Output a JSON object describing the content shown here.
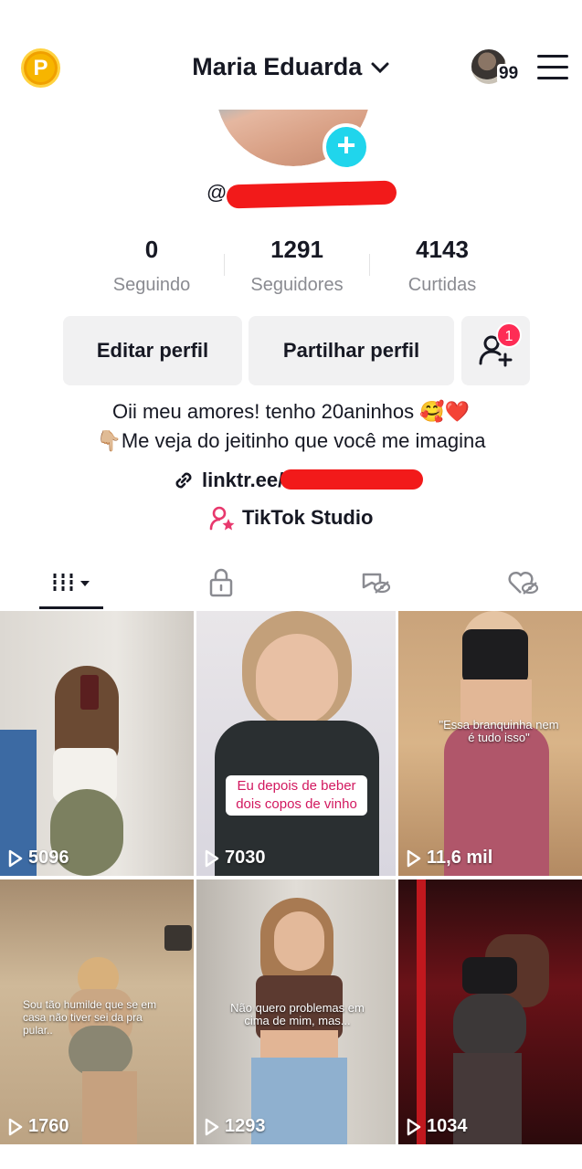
{
  "header": {
    "coin_label": "P",
    "title": "Maria Eduarda",
    "friends_count": "99"
  },
  "profile": {
    "handle_prefix": "@",
    "stats": [
      {
        "value": "0",
        "label": "Seguindo"
      },
      {
        "value": "1291",
        "label": "Seguidores"
      },
      {
        "value": "4143",
        "label": "Curtidas"
      }
    ],
    "buttons": {
      "edit": "Editar perfil",
      "share": "Partilhar perfil",
      "add_friends_badge": "1"
    },
    "bio_line1": "Oii meu amores! tenho 20aninhos 🥰❤️",
    "bio_line2": "👇🏼Me veja do jeitinho que você me imagina",
    "link_prefix": "linktr.ee/",
    "studio_label": "TikTok Studio"
  },
  "tabs": [
    "videos-tab",
    "private-tab",
    "reposts-tab",
    "liked-tab"
  ],
  "videos": [
    {
      "views": "5096",
      "caption": ""
    },
    {
      "views": "7030",
      "caption": "Eu depois de beber dois copos de vinho"
    },
    {
      "views": "11,6 mil",
      "caption": "\"Essa branquinha nem é tudo isso\""
    },
    {
      "views": "1760",
      "caption": "Sou tão humilde que se em casa não tiver sei da pra pular.."
    },
    {
      "views": "1293",
      "caption": "Não quero problemas em cima de mim, mas..."
    },
    {
      "views": "1034",
      "caption": ""
    }
  ],
  "colors": {
    "accent_cyan": "#20d5ec",
    "badge_red": "#fe2c55",
    "coin": "#f7b500"
  }
}
